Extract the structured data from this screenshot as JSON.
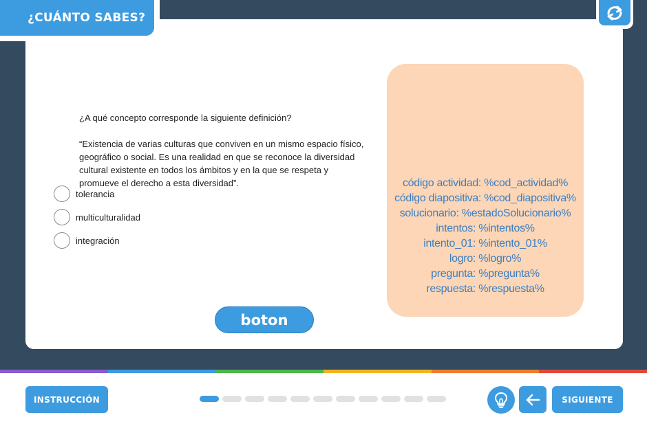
{
  "header": {
    "title": "¿CUÁNTO SABES?",
    "reload_icon": "reload-icon"
  },
  "question": {
    "prompt": "¿A qué concepto corresponde la siguiente definición?",
    "definition": "“Existencia de varias culturas que conviven en un mismo espacio físico, geográfico o social. Es una realidad en que se reconoce la diversidad cultural existente en todos los ámbitos y en la que se respeta y promueve el derecho a esta diversidad”."
  },
  "options": [
    {
      "label": "tolerancia"
    },
    {
      "label": "multiculturalidad"
    },
    {
      "label": "integración"
    }
  ],
  "action_button": {
    "label": "boton"
  },
  "info_panel": {
    "lines": [
      "código actividad: %cod_actividad%",
      "código diapositiva: %cod_diapositiva%",
      "solucionario: %estadoSolucionario%",
      "intentos: %intentos%",
      "intento_01: %intento_01%",
      "logro: %logro%",
      "pregunta: %pregunta%",
      "respuesta: %respuesta%"
    ]
  },
  "footer": {
    "instruction_label": "INSTRUCCIÓN",
    "next_label": "SIGUIENTE",
    "hint_icon": "lightbulb-icon",
    "back_icon": "arrow-left-icon",
    "progress": {
      "total": 11,
      "current": 1
    }
  },
  "colors": {
    "accent": "#3d9be0",
    "frame": "#344a5e",
    "info_bg": "#fcd6b6",
    "info_text": "#3b7fc4",
    "rainbow": [
      "#8a5bd1",
      "#3d9be0",
      "#4cb84a",
      "#f2b51f",
      "#ee7d2e",
      "#e04a3c"
    ]
  }
}
